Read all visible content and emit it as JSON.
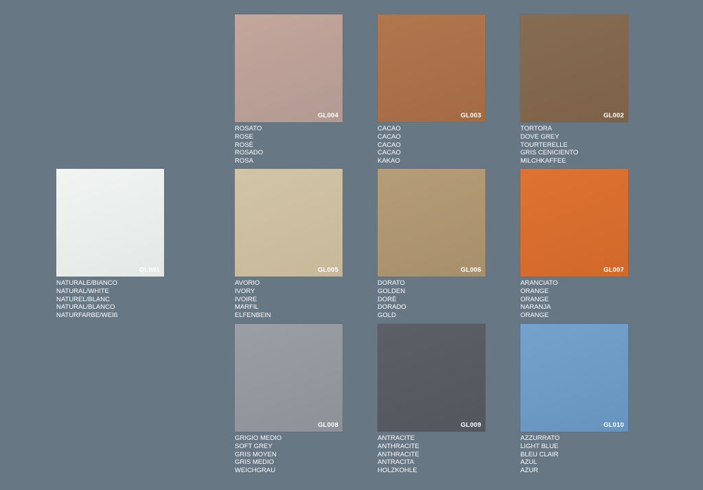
{
  "swatches": [
    {
      "code": "GL004",
      "color": "#c4a69c",
      "color_dark": "#b29a92",
      "names": [
        "ROSATO",
        "ROSE",
        "ROSÈ",
        "ROSADO",
        "ROSA"
      ]
    },
    {
      "code": "GL003",
      "color": "#b0774f",
      "color_dark": "#a36b44",
      "names": [
        "CACAO",
        "CACAO",
        "CACAO",
        "CACAO",
        "KAKAO"
      ]
    },
    {
      "code": "GL002",
      "color": "#866c50",
      "color_dark": "#7d6248",
      "names": [
        "TORTORA",
        "DOVE GREY",
        "TOURTERELLE",
        "GRIS CENICIENTO",
        "MILCHKAFFEE"
      ]
    },
    {
      "code": "GL001",
      "color": "#f1f4f2",
      "color_dark": "#e3e8e6",
      "names": [
        "NATURALE/BIANCO",
        "NATURAL/WHITE",
        "NATUREL/BLANC",
        "NATURAL/BLANCO",
        "NATURFARBE/WEIß"
      ]
    },
    {
      "code": "GL005",
      "color": "#d2c5a7",
      "color_dark": "#c6b898",
      "names": [
        "AVORIO",
        "IVORY",
        "IVOIRE",
        "MARFIL",
        "ELFENBEIN"
      ]
    },
    {
      "code": "GL006",
      "color": "#b59d78",
      "color_dark": "#a88f6b",
      "names": [
        "DORATO",
        "GOLDEN",
        "DORÈ",
        "DORADO",
        "GOLD"
      ]
    },
    {
      "code": "GL007",
      "color": "#de7232",
      "color_dark": "#d1692a",
      "names": [
        "ARANCIATO",
        "ORANGE",
        "ORANGE",
        "NARANJA",
        "ORANGE"
      ]
    },
    {
      "code": "GL008",
      "color": "#9a9ea5",
      "color_dark": "#8d9198",
      "names": [
        "GRIGIO MEDIO",
        "SOFT GREY",
        "GRIS MOYEN",
        "GRIS MEDIO",
        "WEICHGRAU"
      ]
    },
    {
      "code": "GL009",
      "color": "#5c6066",
      "color_dark": "#53575d",
      "names": [
        "ANTRACITE",
        "ANTHRACITE",
        "ANTHRACITE",
        "ANTRACITA",
        "HOLZKOHLE"
      ]
    },
    {
      "code": "GL010",
      "color": "#74a2cc",
      "color_dark": "#6694bf",
      "names": [
        "AZZURRATO",
        "LIGHT BLUE",
        "BLEU CLAIR",
        "AZUL",
        "AZUR"
      ]
    }
  ]
}
